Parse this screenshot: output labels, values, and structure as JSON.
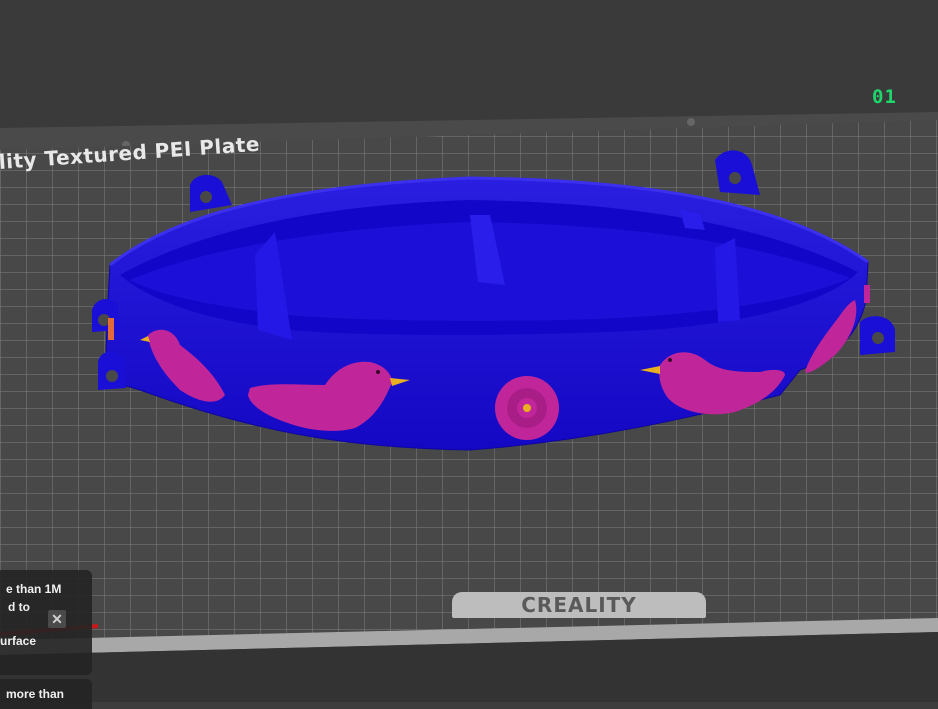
{
  "viewport": {
    "plate_label": "lity Textured PEI Plate",
    "plate_number": "01",
    "bed_brand": "CREALITY",
    "model": {
      "body_color": "#1a0fd6",
      "decor_color": "#c0269a",
      "beak_color": "#e8b020"
    }
  },
  "notifications": [
    {
      "line1": "e than 1M",
      "line2": "d to",
      "link": "urface",
      "close_icon": "close-icon"
    },
    {
      "line3": "more than"
    }
  ]
}
